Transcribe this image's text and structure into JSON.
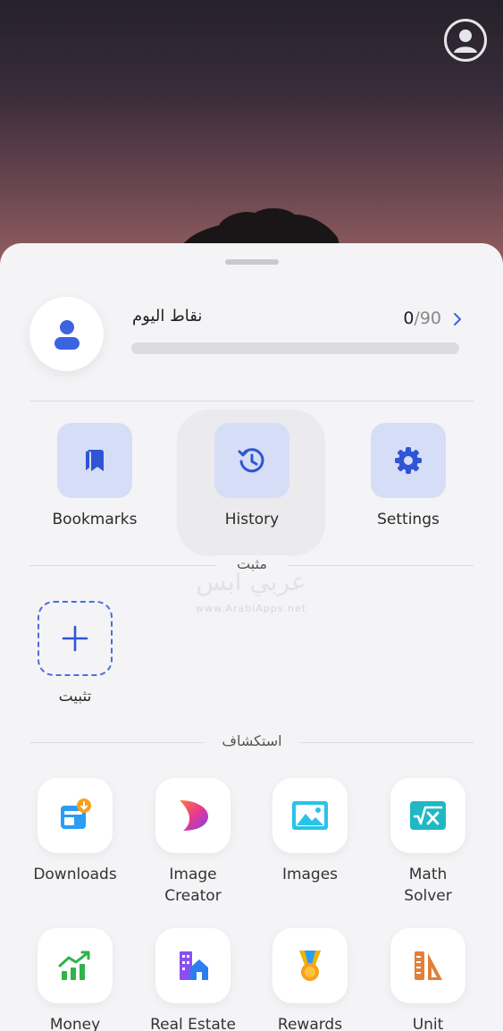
{
  "points": {
    "title": "نقاط اليوم",
    "current": "0",
    "total": "/90",
    "progress_fraction": 0
  },
  "quick_actions": [
    {
      "label": "Bookmarks",
      "icon": "bookmark-icon"
    },
    {
      "label": "History",
      "icon": "history-icon"
    },
    {
      "label": "Settings",
      "icon": "gear-icon"
    }
  ],
  "pinned": {
    "section_label": "مثبت",
    "add_label": "تثبيت"
  },
  "explore": {
    "section_label": "استكشاف",
    "apps": [
      {
        "label": "Downloads",
        "icon": "downloads-icon"
      },
      {
        "label": "Image\nCreator",
        "icon": "image-creator-icon"
      },
      {
        "label": "Images",
        "icon": "images-icon"
      },
      {
        "label": "Math\nSolver",
        "icon": "math-solver-icon"
      },
      {
        "label": "Money",
        "icon": "money-chart-icon"
      },
      {
        "label": "Real Estate",
        "icon": "real-estate-icon"
      },
      {
        "label": "Rewards",
        "icon": "rewards-medal-icon"
      },
      {
        "label": "Unit",
        "icon": "unit-converter-icon"
      }
    ]
  },
  "watermark": {
    "text": "عربي آبس",
    "sub": "www.ArabiApps.net"
  },
  "colors": {
    "accent": "#3c63e0",
    "tile_bg": "#d6ddf6",
    "sheet_bg": "#f4f4f6"
  }
}
